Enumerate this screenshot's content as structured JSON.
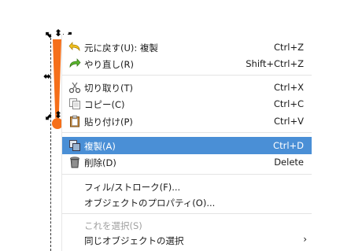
{
  "menu": {
    "items": [
      {
        "label": "元に戻す(U): 複製",
        "shortcut": "Ctrl+Z",
        "icon": "undo-icon"
      },
      {
        "label": "やり直し(R)",
        "shortcut": "Shift+Ctrl+Z",
        "icon": "redo-icon"
      },
      {
        "label": "切り取り(T)",
        "shortcut": "Ctrl+X",
        "icon": "cut-icon"
      },
      {
        "label": "コピー(C)",
        "shortcut": "Ctrl+C",
        "icon": "copy-icon"
      },
      {
        "label": "貼り付け(P)",
        "shortcut": "Ctrl+V",
        "icon": "paste-icon"
      },
      {
        "label": "複製(A)",
        "shortcut": "Ctrl+D",
        "icon": "duplicate-icon"
      },
      {
        "label": "削除(D)",
        "shortcut": "Delete",
        "icon": "delete-icon"
      },
      {
        "label": "フィル/ストローク(F)..."
      },
      {
        "label": "オブジェクトのプロパティ(O)..."
      },
      {
        "label": "これを選択(S)"
      },
      {
        "label": "同じオブジェクトの選択"
      }
    ],
    "submenu_arrow": "›"
  },
  "colors": {
    "selection": "#4a8fd6",
    "shape": "#f56f1a"
  }
}
